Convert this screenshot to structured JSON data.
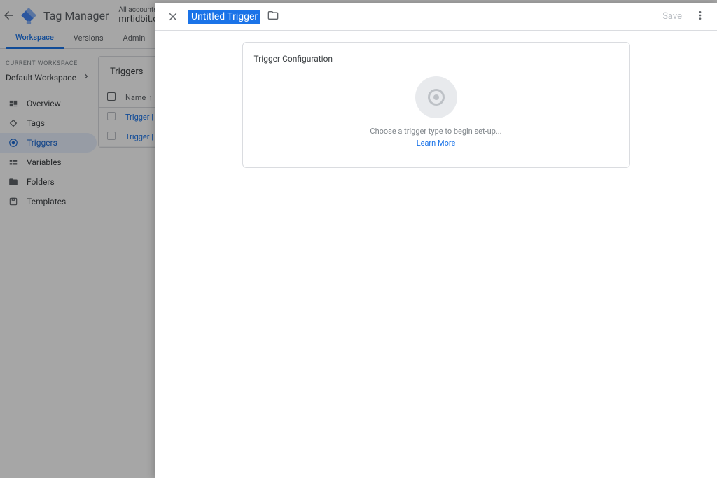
{
  "header": {
    "product": "Tag Manager",
    "breadcrumb_top": "All accounts > Mr Tid",
    "breadcrumb_bottom": "mrtidbit.com"
  },
  "tabs": {
    "workspace": "Workspace",
    "versions": "Versions",
    "admin": "Admin"
  },
  "sidebar": {
    "ws_label": "CURRENT WORKSPACE",
    "ws_name": "Default Workspace",
    "items": {
      "overview": "Overview",
      "tags": "Tags",
      "triggers": "Triggers",
      "variables": "Variables",
      "folders": "Folders",
      "templates": "Templates"
    }
  },
  "panel": {
    "title": "Triggers",
    "col_name": "Name",
    "rows": [
      {
        "name": "Trigger | Cli"
      },
      {
        "name": "Trigger | Pag"
      }
    ]
  },
  "modal": {
    "title": "Untitled Trigger",
    "save": "Save",
    "card_title": "Trigger Configuration",
    "empty_text": "Choose a trigger type to begin set-up...",
    "learn_more": "Learn More"
  }
}
